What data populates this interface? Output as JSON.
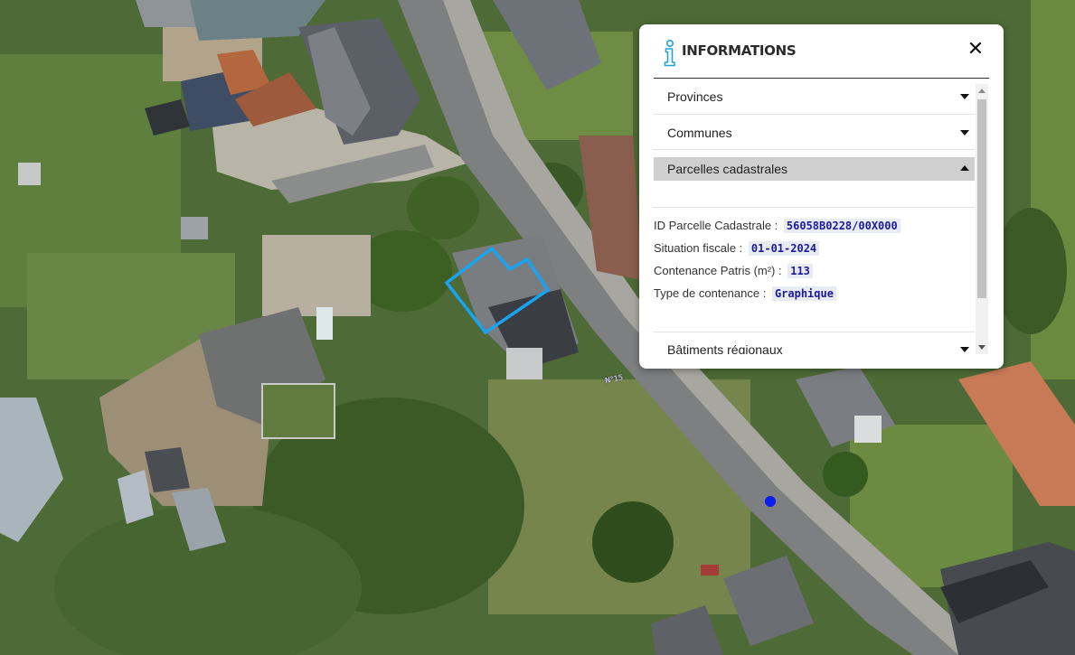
{
  "map": {
    "label_text": "N°15",
    "colors": {
      "parcel_outline": "#1aa3f0",
      "location_marker": "#0b1ef0"
    }
  },
  "info_panel": {
    "title": "INFORMATIONS",
    "close_label": "✕",
    "info_icon": "info-icon",
    "sections": [
      {
        "label": "Provinces",
        "expanded": false
      },
      {
        "label": "Communes",
        "expanded": false
      },
      {
        "label": "Parcelles cadastrales",
        "expanded": true
      },
      {
        "label": "Bâtiments régionaux",
        "expanded": false
      }
    ],
    "parcel_details": {
      "id_label": "ID Parcelle Cadastrale :",
      "id_value": "56058B0228/00X000",
      "fiscal_label": "Situation fiscale :",
      "fiscal_value": "01-01-2024",
      "area_label": "Contenance Patris (m²) :",
      "area_value": "113",
      "type_label": "Type de contenance :",
      "type_value": "Graphique"
    },
    "colors": {
      "icon": "#1ea6d8",
      "value_text": "#1a1aa0",
      "active_section_bg": "#cfcfcf"
    }
  }
}
